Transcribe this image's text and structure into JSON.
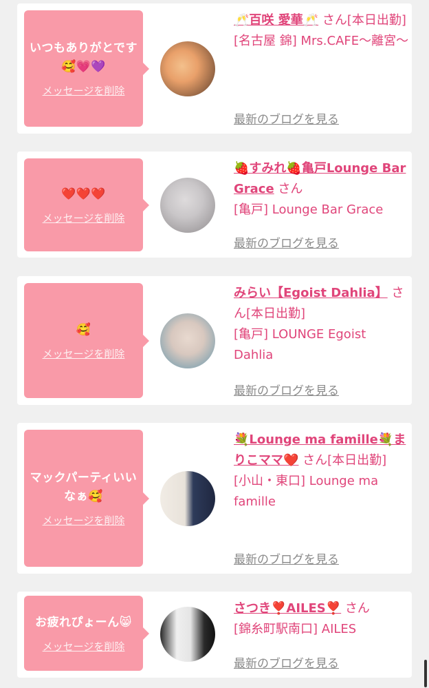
{
  "cards": [
    {
      "message": "いつもありがとです🥰💗💜",
      "delete_label": "メッセージを削除",
      "name": "🥂百咲 愛華🥂",
      "san": "さん[本日出勤]",
      "shop": "[名古屋 錦] Mrs.CAFE〜離宮〜",
      "blog_label": "最新のブログを見る",
      "avatar_colors": [
        "#e9a06a",
        "#5a3d2b"
      ]
    },
    {
      "message": "❤️❤️❤️",
      "delete_label": "メッセージを削除",
      "name": "🍓すみれ🍓亀戸Lounge Bar Grace",
      "san": "さん",
      "shop": "[亀戸] Lounge Bar Grace",
      "blog_label": "最新のブログを見る",
      "avatar_colors": [
        "#c9c6c8",
        "#9a9698"
      ]
    },
    {
      "message": "🥰",
      "delete_label": "メッセージを削除",
      "name": "みらい【Egoist Dahlia】",
      "san": "さん[本日出勤]",
      "shop": "[亀戸] LOUNGE Egoist Dahlia",
      "blog_label": "最新のブログを見る",
      "avatar_colors": [
        "#d8c8bf",
        "#8aa7b3"
      ]
    },
    {
      "message": "マックパーティいいなぁ🥰",
      "delete_label": "メッセージを削除",
      "name": "💐Lounge ma famille💐まりこママ❤️",
      "san": "さん[本日出勤]",
      "shop": "[小山・東口] Lounge ma famille",
      "blog_label": "最新のブログを見る",
      "avatar_colors": [
        "#e8e2da",
        "#2e3b5a"
      ]
    },
    {
      "message": "お疲れぴょーん😸",
      "delete_label": "メッセージを削除",
      "name": "さつき❣️AILES❣️",
      "san": "さん",
      "shop": "[錦糸町駅南口] AILES",
      "blog_label": "最新のブログを見る",
      "avatar_colors": [
        "#e5e5e5",
        "#2a2a2a"
      ]
    }
  ]
}
